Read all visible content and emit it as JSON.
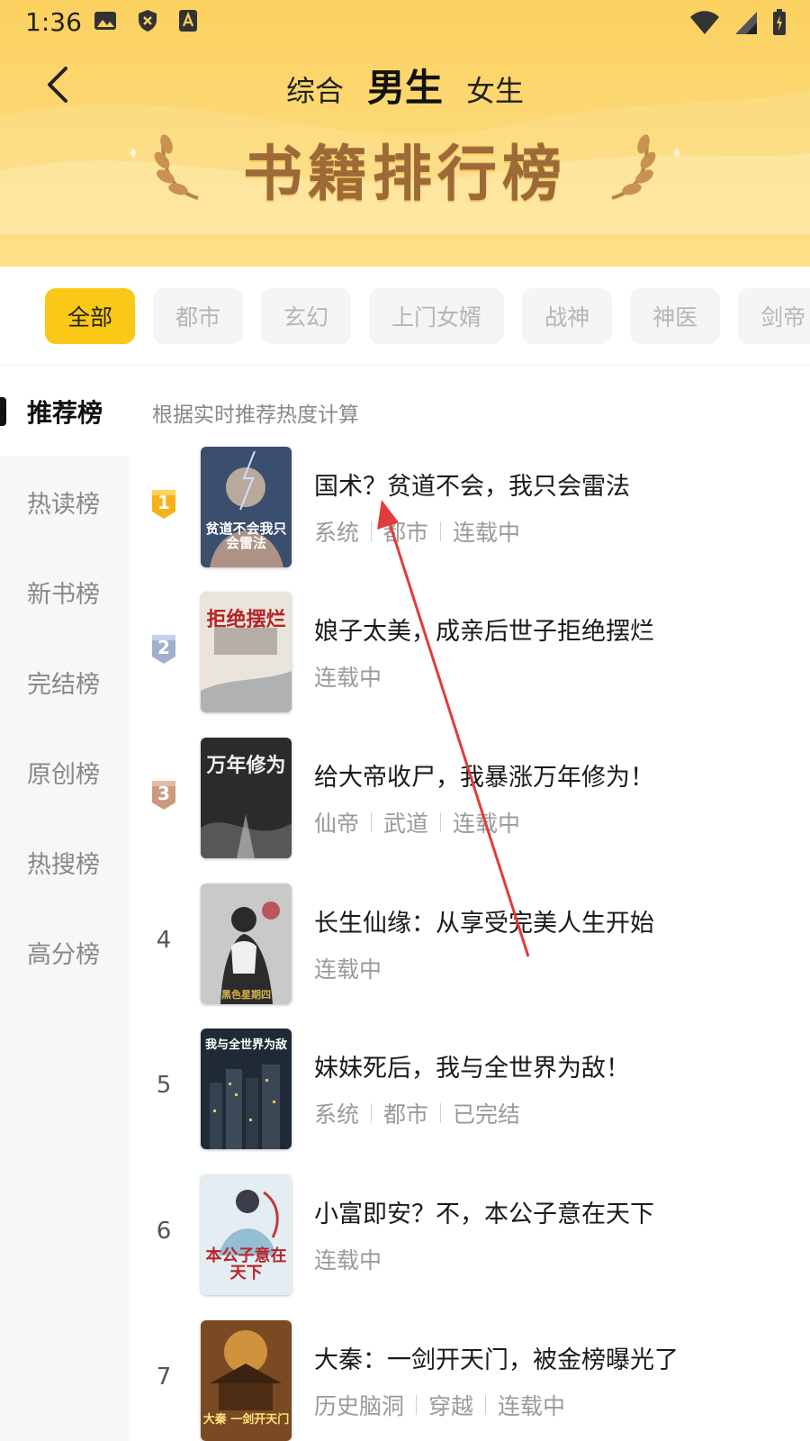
{
  "status_bar": {
    "time": "1:36",
    "left_icons": [
      "image-icon",
      "shield-icon",
      "font-icon"
    ],
    "right_icons": [
      "wifi-icon",
      "signal-icon",
      "battery-icon"
    ]
  },
  "header": {
    "tabs": [
      {
        "label": "综合",
        "active": false
      },
      {
        "label": "男生",
        "active": true
      },
      {
        "label": "女生",
        "active": false
      }
    ],
    "banner_title": "书籍排行榜"
  },
  "categories": [
    {
      "label": "全部",
      "active": true
    },
    {
      "label": "都市",
      "active": false
    },
    {
      "label": "玄幻",
      "active": false
    },
    {
      "label": "上门女婿",
      "active": false
    },
    {
      "label": "战神",
      "active": false
    },
    {
      "label": "神医",
      "active": false
    },
    {
      "label": "剑帝",
      "active": false
    }
  ],
  "sidebar": {
    "items": [
      {
        "label": "推荐榜",
        "active": true
      },
      {
        "label": "热读榜",
        "active": false
      },
      {
        "label": "新书榜",
        "active": false
      },
      {
        "label": "完结榜",
        "active": false
      },
      {
        "label": "原创榜",
        "active": false
      },
      {
        "label": "热搜榜",
        "active": false
      },
      {
        "label": "高分榜",
        "active": false
      }
    ]
  },
  "list": {
    "subtitle": "根据实时推荐热度计算",
    "books": [
      {
        "rank": "1",
        "title": "国术？贫道不会，我只会雷法",
        "tags": [
          "系统",
          "都市",
          "连载中"
        ]
      },
      {
        "rank": "2",
        "title": "娘子太美，成亲后世子拒绝摆烂",
        "tags": [
          "连载中"
        ]
      },
      {
        "rank": "3",
        "title": "给大帝收尸，我暴涨万年修为！",
        "tags": [
          "仙帝",
          "武道",
          "连载中"
        ]
      },
      {
        "rank": "4",
        "title": "长生仙缘：从享受完美人生开始",
        "tags": [
          "连载中"
        ]
      },
      {
        "rank": "5",
        "title": "妹妹死后，我与全世界为敌！",
        "tags": [
          "系统",
          "都市",
          "已完结"
        ]
      },
      {
        "rank": "6",
        "title": "小富即安？不，本公子意在天下",
        "tags": [
          "连载中"
        ]
      },
      {
        "rank": "7",
        "title": "大秦：一剑开天门，被金榜曝光了",
        "tags": [
          "历史脑洞",
          "穿越",
          "连载中"
        ]
      }
    ],
    "covers": [
      {
        "text": "贫道不会我只会雷法",
        "bg": "#3a4e6e",
        "fg": "#ffffff"
      },
      {
        "text": "拒绝摆烂",
        "bg": "#e9e4dc",
        "fg": "#b3252a"
      },
      {
        "text": "万年修为",
        "bg": "#2b2b2b",
        "fg": "#f2f2f2"
      },
      {
        "text": "黑色星期四",
        "bg": "#c9c9c9",
        "fg": "#1a1a1a"
      },
      {
        "text": "我与全世界为敌",
        "bg": "#1f2a36",
        "fg": "#ffffff"
      },
      {
        "text": "本公子意在天下",
        "bg": "#e4eef2",
        "fg": "#b8242a"
      },
      {
        "text": "大秦 一剑开天门",
        "bg": "#7a4a24",
        "fg": "#ffe07a"
      }
    ]
  },
  "colors": {
    "header_yellow": "#fbd15f",
    "chip_active": "#fac816",
    "badge_gold": "#f6b21a",
    "badge_silver": "#9fb0cf",
    "badge_bronze": "#c99a7e",
    "annotation_arrow": "#e03c3c"
  }
}
